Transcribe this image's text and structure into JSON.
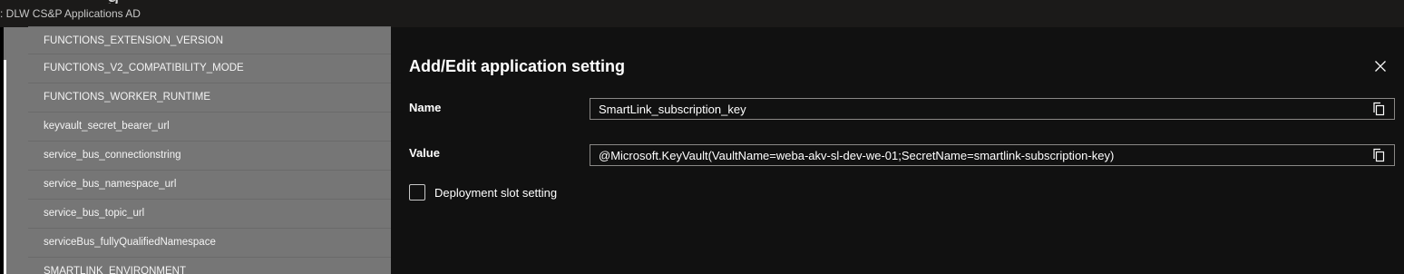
{
  "header": {
    "title_fragment": "g",
    "subtitle": ": DLW CS&P Applications AD"
  },
  "settings_list": {
    "rows": [
      "FUNCTIONS_EXTENSION_VERSION",
      "FUNCTIONS_V2_COMPATIBILITY_MODE",
      "FUNCTIONS_WORKER_RUNTIME",
      "keyvault_secret_bearer_url",
      "service_bus_connectionstring",
      "service_bus_namespace_url",
      "service_bus_topic_url",
      "serviceBus_fullyQualifiedNamespace",
      "SMARTLINK_ENVIRONMENT"
    ]
  },
  "panel": {
    "title": "Add/Edit application setting",
    "close_icon": "close-icon",
    "name": {
      "label": "Name",
      "value": "SmartLink_subscription_key",
      "copy_icon": "copy-icon"
    },
    "value": {
      "label": "Value",
      "value": "@Microsoft.KeyVault(VaultName=weba-akv-sl-dev-we-01;SecretName=smartlink-subscription-key)",
      "copy_icon": "copy-icon"
    },
    "deployment_slot": {
      "label": "Deployment slot setting",
      "checked": false
    }
  },
  "colors": {
    "panel_bg": "#111111",
    "overlay_list_bg": "#767676",
    "input_border": "#8a8886",
    "text": "#ffffff"
  }
}
